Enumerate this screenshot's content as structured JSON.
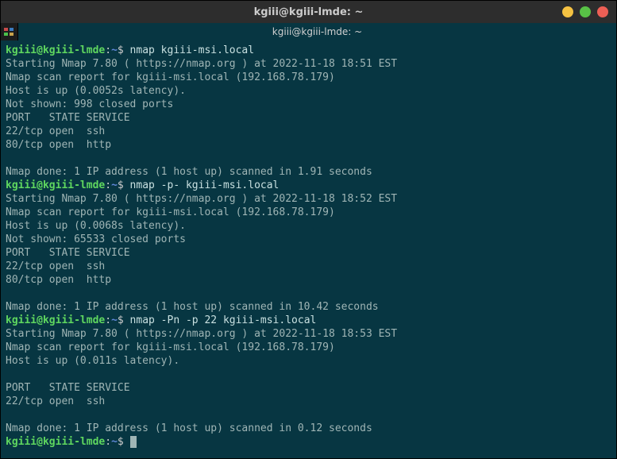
{
  "titlebar": {
    "title": "kgiii@kgiii-lmde: ~"
  },
  "tab": {
    "label": "kgiii@kgiii-lmde: ~"
  },
  "prompt": {
    "user_host": "kgiii@kgiii-lmde",
    "sep": ":",
    "path": "~",
    "dollar": "$"
  },
  "blocks": [
    {
      "cmd": " nmap kgiii-msi.local",
      "out": [
        "Starting Nmap 7.80 ( https://nmap.org ) at 2022-11-18 18:51 EST",
        "Nmap scan report for kgiii-msi.local (192.168.78.179)",
        "Host is up (0.0052s latency).",
        "Not shown: 998 closed ports",
        "PORT   STATE SERVICE",
        "22/tcp open  ssh",
        "80/tcp open  http",
        "",
        "Nmap done: 1 IP address (1 host up) scanned in 1.91 seconds"
      ]
    },
    {
      "cmd": " nmap -p- kgiii-msi.local",
      "out": [
        "Starting Nmap 7.80 ( https://nmap.org ) at 2022-11-18 18:52 EST",
        "Nmap scan report for kgiii-msi.local (192.168.78.179)",
        "Host is up (0.0068s latency).",
        "Not shown: 65533 closed ports",
        "PORT   STATE SERVICE",
        "22/tcp open  ssh",
        "80/tcp open  http",
        "",
        "Nmap done: 1 IP address (1 host up) scanned in 10.42 seconds"
      ]
    },
    {
      "cmd": " nmap -Pn -p 22 kgiii-msi.local",
      "out": [
        "Starting Nmap 7.80 ( https://nmap.org ) at 2022-11-18 18:53 EST",
        "Nmap scan report for kgiii-msi.local (192.168.78.179)",
        "Host is up (0.011s latency).",
        "",
        "PORT   STATE SERVICE",
        "22/tcp open  ssh",
        "",
        "Nmap done: 1 IP address (1 host up) scanned in 0.12 seconds"
      ]
    }
  ]
}
